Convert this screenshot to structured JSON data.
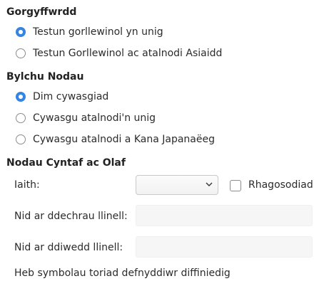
{
  "section_gorgyffwrdd": {
    "heading": "Gorgyffwrdd",
    "options": [
      {
        "label": "Testun gorllewinol yn unig",
        "checked": true
      },
      {
        "label": "Testun Gorllewinol ac atalnodi Asiaidd",
        "checked": false
      }
    ]
  },
  "section_bylchu": {
    "heading": "Bylchu Nodau",
    "options": [
      {
        "label": "Dim cywasgiad",
        "checked": true
      },
      {
        "label": "Cywasgu atalnodi'n unig",
        "checked": false
      },
      {
        "label": "Cywasgu atalnodi a Kana Japanaëeg",
        "checked": false
      }
    ]
  },
  "section_nodau": {
    "heading": "Nodau Cyntaf ac Olaf",
    "language_label": "Iaith:",
    "language_value": "",
    "default_checkbox_label": "Rhagosodiad",
    "default_checked": false,
    "start_label": "Nid ar ddechrau llinell:",
    "start_value": "",
    "end_label": "Nid ar ddiwedd llinell:",
    "end_value": "",
    "status_text": "Heb symbolau toriad defnyddiwr diffiniedig"
  },
  "icons": {
    "dropdown": "chevron-down-icon"
  }
}
